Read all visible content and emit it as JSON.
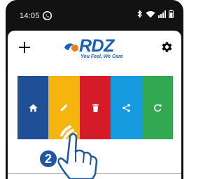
{
  "status_bar": {
    "time": "14:05",
    "icons": [
      "whatsapp-icon",
      "bluetooth-icon",
      "wifi-icon",
      "signal-icon",
      "battery-icon"
    ]
  },
  "header": {
    "add_icon": "plus-icon",
    "brand": {
      "name": "RDZ",
      "tagline": "You Feel, We Care"
    },
    "settings_icon": "gear-icon"
  },
  "actions": [
    {
      "name": "home",
      "icon": "home-icon",
      "color": "#1f4f96"
    },
    {
      "name": "edit",
      "icon": "pencil-icon",
      "color": "#f5b50e"
    },
    {
      "name": "delete",
      "icon": "trash-icon",
      "color": "#d51a2a"
    },
    {
      "name": "share",
      "icon": "share-icon",
      "color": "#169be0"
    },
    {
      "name": "refresh",
      "icon": "refresh-icon",
      "color": "#33a853"
    }
  ],
  "overlay": {
    "step": "2",
    "icon": "tap-hand-icon"
  }
}
